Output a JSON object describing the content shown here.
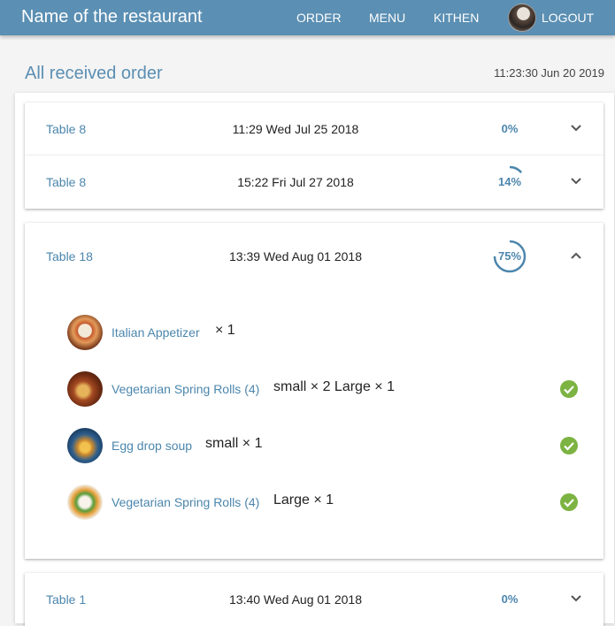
{
  "header": {
    "brand": "Name of the restaurant",
    "nav": {
      "order": "ORDER",
      "menu": "MENU",
      "kitchen": "KITHEN",
      "logout": "LOGOUT"
    }
  },
  "page": {
    "title": "All received order",
    "timestamp": "11:23:30 Jun 20 2019"
  },
  "orders": [
    {
      "table": "Table 8",
      "time": "11:29 Wed Jul 25 2018",
      "progress_label": "0%",
      "progress": 0,
      "expanded": false
    },
    {
      "table": "Table 8",
      "time": "15:22 Fri Jul 27 2018",
      "progress_label": "14%",
      "progress": 14,
      "expanded": false
    },
    {
      "table": "Table 18",
      "time": "13:39 Wed Aug 01 2018",
      "progress_label": "75%",
      "progress": 75,
      "expanded": true,
      "items": [
        {
          "name": "Italian Appetizer",
          "qty": "× 1",
          "done": false,
          "thumb_icon": "italian-appetizer-photo"
        },
        {
          "name": "Vegetarian Spring Rolls (4)",
          "qty": "small × 2 Large × 1",
          "done": true,
          "thumb_icon": "spring-rolls-photo"
        },
        {
          "name": "Egg drop soup",
          "qty": "small × 1",
          "done": true,
          "thumb_icon": "egg-drop-soup-photo"
        },
        {
          "name": "Vegetarian Spring Rolls (4)",
          "qty": "Large × 1",
          "done": true,
          "thumb_icon": "spring-rolls-photo"
        }
      ]
    },
    {
      "table": "Table 1",
      "time": "13:40 Wed Aug 01 2018",
      "progress_label": "0%",
      "progress": 0,
      "expanded": false
    }
  ],
  "colors": {
    "navbar": "#5b8fb3",
    "link": "#4c86ad",
    "check": "#7cb342",
    "progress_track": "#dfe9f0"
  }
}
